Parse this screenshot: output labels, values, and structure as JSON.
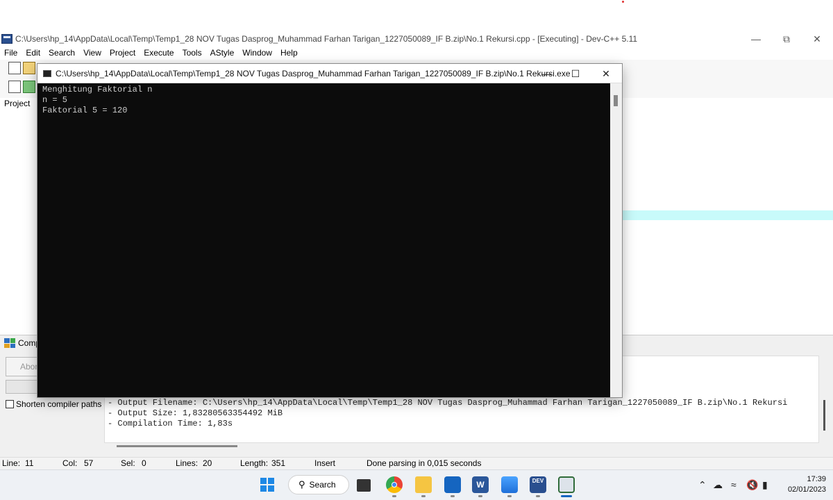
{
  "devcpp": {
    "title": "C:\\Users\\hp_14\\AppData\\Local\\Temp\\Temp1_28 NOV Tugas Dasprog_Muhammad Farhan Tarigan_1227050089_IF B.zip\\No.1 Rekursi.cpp - [Executing] - Dev-C++ 5.11",
    "menu": [
      "File",
      "Edit",
      "Search",
      "View",
      "Project",
      "Execute",
      "Tools",
      "AStyle",
      "Window",
      "Help"
    ],
    "project_tab": "Project",
    "compiler_tab": "Comp",
    "abort_label": "Abor",
    "shorten_label": "Shorten compiler paths",
    "log": [
      "- Output Filename: C:\\Users\\hp_14\\AppData\\Local\\Temp\\Temp1_28 NOV Tugas Dasprog_Muhammad Farhan Tarigan_1227050089_IF B.zip\\No.1 Rekursi",
      "- Output Size: 1,83280563354492 MiB",
      "- Compilation Time: 1,83s"
    ],
    "status": {
      "line_label": "Line:",
      "line_value": "11",
      "col_label": "Col:",
      "col_value": "57",
      "sel_label": "Sel:",
      "sel_value": "0",
      "lines_label": "Lines:",
      "lines_value": "20",
      "length_label": "Length:",
      "length_value": "351",
      "mode": "Insert",
      "message": "Done parsing in 0,015 seconds"
    }
  },
  "console": {
    "title": "C:\\Users\\hp_14\\AppData\\Local\\Temp\\Temp1_28 NOV Tugas Dasprog_Muhammad Farhan Tarigan_1227050089_IF B.zip\\No.1 Rekursi.exe",
    "lines": [
      "Menghitung Faktorial n",
      "n = 5",
      "Faktorial 5 = 120"
    ]
  },
  "taskbar": {
    "search_label": "Search",
    "time": "17:39",
    "date": "02/01/2023",
    "dev_label": "DEV"
  },
  "colors": {
    "console_bg": "#0c0c0c",
    "console_text": "#cccccc",
    "highlight_line": "#c8fafa"
  }
}
